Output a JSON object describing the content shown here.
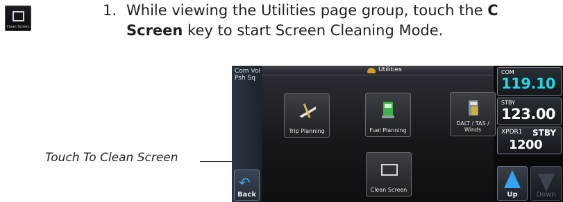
{
  "step": {
    "number": "1.",
    "text_before": "While viewing the Utilities page group, touch the ",
    "key_part1": "C",
    "key_part2": "Screen",
    "text_after": " key to start Screen Cleaning Mode."
  },
  "icon": {
    "label": "Clean Screen"
  },
  "callout": {
    "label": "Touch To Clean Screen"
  },
  "device": {
    "com_vol": "Com Vol\nPsh Sq",
    "title": "Utilities",
    "tiles": [
      {
        "label": "Trip Planning"
      },
      {
        "label": "Fuel Planning"
      },
      {
        "label": "DALT / TAS /\nWinds"
      },
      {
        "label": "Clean Screen"
      }
    ],
    "back_label": "Back",
    "com": {
      "label": "COM",
      "freq": "119.10"
    },
    "stby": {
      "label": "STBY",
      "freq": "123.00"
    },
    "xpdr": {
      "label": "XPDR1",
      "mode": "STBY",
      "code": "1200"
    },
    "up_label": "Up",
    "down_label": "Down"
  }
}
